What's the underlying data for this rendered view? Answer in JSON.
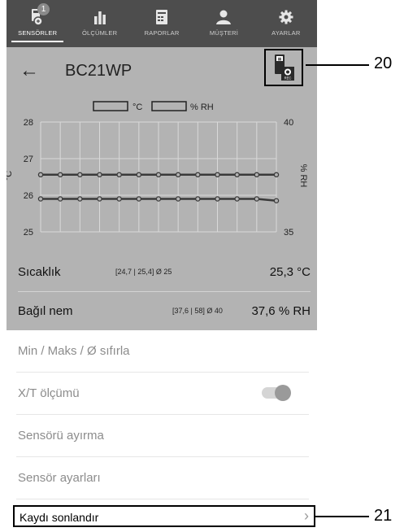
{
  "nav": {
    "badge_count": "1",
    "items": [
      {
        "label": "SENSÖRLER",
        "icon": "sensor-icon"
      },
      {
        "label": "ÖLÇÜMLER",
        "icon": "bar-chart-icon"
      },
      {
        "label": "RAPORLAR",
        "icon": "report-icon"
      },
      {
        "label": "MÜŞTERİ",
        "icon": "user-icon"
      },
      {
        "label": "AYARLAR",
        "icon": "gear-icon"
      }
    ]
  },
  "header": {
    "title": "BC21WP",
    "back_icon": "back-arrow-icon",
    "rec_icon": "recording-device-icon",
    "rec_text": "REC"
  },
  "chart_data": {
    "type": "line",
    "legend": [
      "°C",
      "% RH"
    ],
    "ylabel_left": "°C",
    "ylabel_right": "% RH",
    "left_ticks": [
      "28",
      "27",
      "26",
      "25"
    ],
    "right_ticks": [
      "40",
      "35"
    ],
    "ylim_left": [
      25,
      28
    ],
    "ylim_right": [
      35,
      40
    ],
    "grid": true,
    "series": [
      {
        "name": "% RH",
        "axis": "right",
        "values": [
          37.6,
          37.6,
          37.6,
          37.6,
          37.6,
          37.6,
          37.6,
          37.6,
          37.6,
          37.6,
          37.6,
          37.6,
          37.6
        ]
      },
      {
        "name": "°C",
        "axis": "left",
        "values": [
          25.9,
          25.9,
          25.9,
          25.9,
          25.9,
          25.9,
          25.9,
          25.9,
          25.9,
          25.9,
          25.9,
          25.9,
          25.85
        ]
      }
    ]
  },
  "readings": [
    {
      "name": "Sıcaklık",
      "stats": "[24,7 | 25,4]  Ø 25",
      "value": "25,3 °C"
    },
    {
      "name": "Bağıl nem",
      "stats": "[37,6 | 58]  Ø 40",
      "value": "37,6 % RH"
    }
  ],
  "menu": {
    "reset_label": "Min / Maks / Ø sıfırla",
    "xt_label": "X/T ölçümü",
    "xt_enabled": true,
    "detach_label": "Sensörü ayırma",
    "settings_label": "Sensör ayarları",
    "end_record_label": "Kaydı sonlandır",
    "chevron_icon": "chevron-right-icon"
  },
  "callouts": [
    "20",
    "21"
  ]
}
